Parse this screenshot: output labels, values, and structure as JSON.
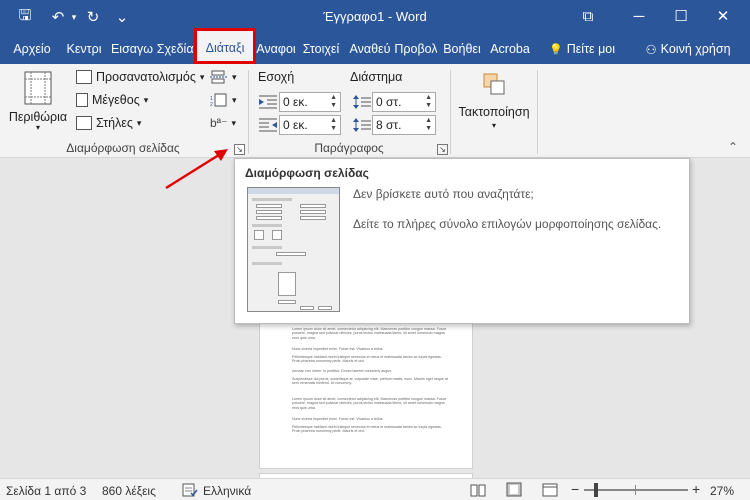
{
  "window": {
    "title": "Έγγραφο1 - Word",
    "minimize_glyph": "─",
    "maximize_glyph": "☐",
    "close_glyph": "✕",
    "restore_glyph": "⧉"
  },
  "quick_access": {
    "save_glyph": "🖫",
    "undo_glyph": "↶",
    "redo_glyph": "↻",
    "customize_glyph": "⌄"
  },
  "tabs": [
    {
      "label": "Αρχείο"
    },
    {
      "label": "Κεντρι"
    },
    {
      "label": "Εισαγω"
    },
    {
      "label": "Σχεδίασ"
    },
    {
      "label": "Διάταξι"
    },
    {
      "label": "Αναφοι"
    },
    {
      "label": "Στοιχεί"
    },
    {
      "label": "Αναθεύ"
    },
    {
      "label": "Προβολ"
    },
    {
      "label": "Βοήθει"
    },
    {
      "label": "Acroba"
    }
  ],
  "tell_me": {
    "icon_glyph": "💡",
    "label": "Πείτε μοι"
  },
  "share": {
    "icon_glyph": "⚇",
    "label": "Κοινή χρήση"
  },
  "ribbon": {
    "margins_label": "Περιθώρια",
    "orientation_label": "Προσανατολισμός",
    "size_label": "Μέγεθος",
    "columns_label": "Στήλες",
    "dropdown_glyph": "▾",
    "hyphen_glyph": "bª⁻",
    "page_setup_group": "Διαμόρφωση σελίδας",
    "indent_label": "Εσοχή",
    "spacing_label": "Διάστημα",
    "indent_left": "0 εκ.",
    "indent_right": "0 εκ.",
    "spacing_before": "0 στ.",
    "spacing_after": "8 στ.",
    "paragraph_group": "Παράγραφος",
    "arrange_label": "Τακτοποίηση",
    "collapse_glyph": "⌃",
    "launcher_glyph": "↘"
  },
  "tooltip": {
    "title": "Διαμόρφωση σελίδας",
    "line1": "Δεν βρίσκετε αυτό που αναζητάτε;",
    "line2": "Δείτε το πλήρες σύνολο επιλογών μορφοποίησης σελίδας."
  },
  "status": {
    "page": "Σελίδα 1 από 3",
    "words": "860 λέξεις",
    "language": "Ελληνικά",
    "zoom": "27%",
    "zoom_out": "−",
    "zoom_in": "+",
    "zoom_fraction": 0.27
  },
  "colors": {
    "accent": "#2b579a",
    "highlight": "#e00000"
  }
}
